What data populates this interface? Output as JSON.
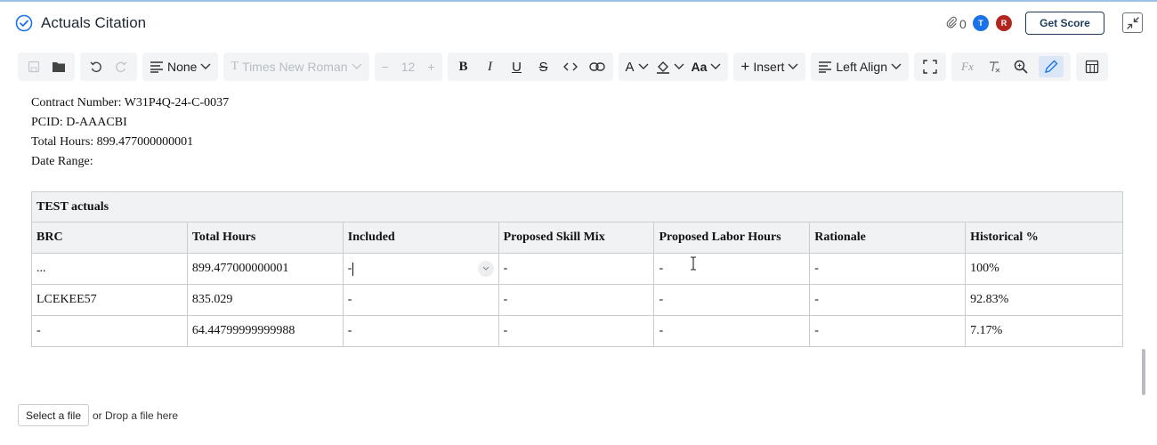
{
  "header": {
    "title": "Actuals Citation",
    "attachment_count": "0",
    "avatars": [
      "T",
      "R"
    ],
    "get_score_label": "Get Score"
  },
  "toolbar": {
    "block_style": "None",
    "font_family": "Times New Roman",
    "font_size": "12",
    "insert_label": "Insert",
    "align_label": "Left Align",
    "case_label": "Aa",
    "icons": [
      "save-icon",
      "folder-icon",
      "undo-icon",
      "redo-icon",
      "paragraph-icon",
      "font-icon",
      "minus-icon",
      "plus-icon",
      "bold-icon",
      "italic-icon",
      "underline-icon",
      "strikethrough-icon",
      "code-icon",
      "link-icon",
      "font-color-icon",
      "highlight-icon",
      "insert-plus-icon",
      "align-left-icon",
      "fullscreen-icon",
      "formula-icon",
      "clear-format-icon",
      "search-icon",
      "pen-icon",
      "table-icon"
    ]
  },
  "document": {
    "lines": [
      {
        "label": "Contract Number:",
        "value": "Contract Number: W31P4Q-24-C-0037"
      },
      {
        "label": "PCID:",
        "value": "PCID: D-AAACBI"
      },
      {
        "label": "Total Hours:",
        "value": "Total Hours: 899.477000000001"
      },
      {
        "label": "Date Range:",
        "value": ""
      }
    ]
  },
  "table": {
    "caption": "TEST actuals",
    "columns": [
      "BRC",
      "Total Hours",
      "Included",
      "Proposed Skill Mix",
      "Proposed Labor Hours",
      "Rationale",
      "Historical %"
    ],
    "rows": [
      [
        "...",
        "899.477000000001",
        "-",
        "-",
        "-",
        "-",
        "100%"
      ],
      [
        "LCEKEE57",
        "835.029",
        "-",
        "-",
        "-",
        "-",
        "92.83%"
      ],
      [
        "-",
        "64.44799999999988",
        "-",
        "-",
        "-",
        "-",
        "7.17%"
      ]
    ]
  },
  "upload": {
    "select_label": "Select a file",
    "drop_label": "or Drop a file here"
  },
  "colors": {
    "accent": "#1a73e8",
    "avatar_t": "#1a73e8",
    "avatar_r": "#b3261e",
    "score_border": "#1f3b5c"
  }
}
